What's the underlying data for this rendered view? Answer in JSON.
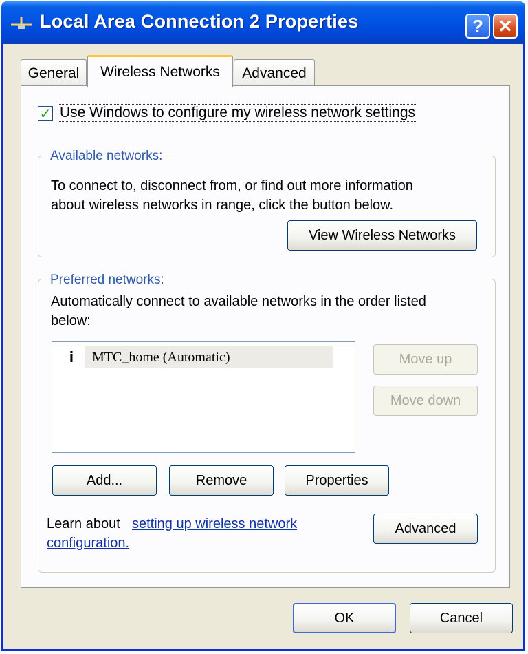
{
  "window": {
    "title": "Local Area Connection 2 Properties",
    "help_glyph": "?",
    "close_glyph": "✕",
    "title_color": "#0054e3"
  },
  "tabs": [
    {
      "label": "General"
    },
    {
      "label": "Wireless Networks"
    },
    {
      "label": "Advanced"
    }
  ],
  "config_checkbox": {
    "checked": true,
    "glyph": "✓",
    "label": "Use Windows to configure my wireless network settings"
  },
  "available": {
    "legend": "Available networks:",
    "description_line1": "To connect to, disconnect from, or find out more information",
    "description_line2": "about wireless networks in range, click the button below.",
    "view_button": "View Wireless Networks"
  },
  "preferred": {
    "legend": "Preferred networks:",
    "description_line1": "Automatically connect to available networks in the order listed",
    "description_line2": "below:",
    "networks": [
      {
        "icon": "wireless-antenna-icon",
        "glyph": "𝐢",
        "name": "MTC_home (Automatic)"
      }
    ],
    "move_up": "Move up",
    "move_down": "Move down",
    "add": "Add...",
    "remove": "Remove",
    "properties": "Properties"
  },
  "learn": {
    "prefix": "Learn about",
    "link_line1": "setting up wireless network",
    "link_line2": "configuration.",
    "advanced_button": "Advanced"
  },
  "footer": {
    "ok": "OK",
    "cancel": "Cancel"
  }
}
